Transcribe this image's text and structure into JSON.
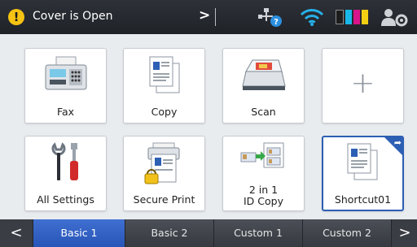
{
  "status_bar": {
    "message": "Cover is Open",
    "warning_icon_glyph": "!",
    "expand_glyph": ">",
    "icons": [
      "warning-icon",
      "expand-icon",
      "network-help-icon",
      "wifi-icon",
      "toner-level-icon",
      "user-settings-icon"
    ],
    "toner_colors": [
      "#1c1c1c",
      "#19b7e8",
      "#d7148a",
      "#f3cf13"
    ]
  },
  "tiles": {
    "fax": "Fax",
    "copy": "Copy",
    "scan": "Scan",
    "add_glyph": "+",
    "all_settings": "All Settings",
    "secure_print": "Secure Print",
    "id_copy_line1": "2 in 1",
    "id_copy_line2": "ID Copy",
    "shortcut": "Shortcut01"
  },
  "tabs": {
    "prev_glyph": "<",
    "next_glyph": ">",
    "items": [
      "Basic 1",
      "Basic 2",
      "Custom 1",
      "Custom 2"
    ],
    "active": "Basic 1"
  },
  "colors": {
    "accent": "#2d5fb4",
    "warning": "#f6c213",
    "status_bar": "#25282e"
  }
}
